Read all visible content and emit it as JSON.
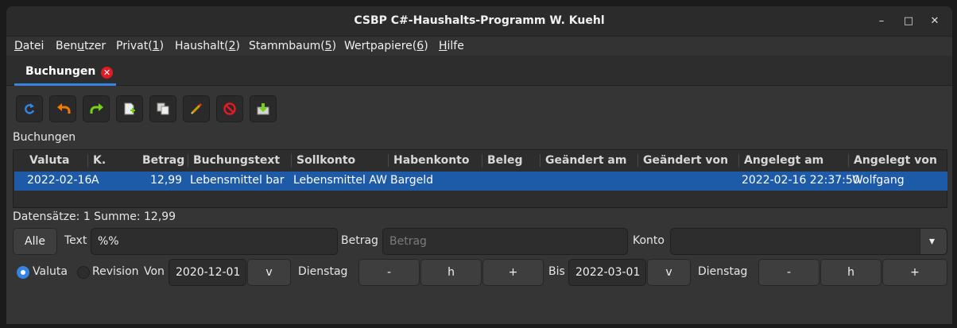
{
  "window": {
    "title": "CSBP C#-Haushalts-Programm W. Kuehl",
    "minimize_glyph": "–",
    "maximize_glyph": "□",
    "close_glyph": "✕"
  },
  "menu": [
    {
      "pre": "",
      "u": "D",
      "post": "atei"
    },
    {
      "pre": "Ben",
      "u": "u",
      "post": "tzer"
    },
    {
      "pre": "Privat(",
      "u": "1",
      "post": ")"
    },
    {
      "pre": "Haushalt(",
      "u": "2",
      "post": ")"
    },
    {
      "pre": "Stammbaum(",
      "u": "5",
      "post": ")"
    },
    {
      "pre": "Wertpapiere(",
      "u": "6",
      "post": ")"
    },
    {
      "pre": "",
      "u": "H",
      "post": "ilfe"
    }
  ],
  "tab": {
    "label": "Buchungen",
    "close_glyph": "✕"
  },
  "toolbar": {
    "icons": [
      "refresh-icon",
      "undo-icon",
      "redo-icon",
      "new-document-icon",
      "copy-icon",
      "edit-pencil-icon",
      "delete-icon",
      "export-icon"
    ],
    "colors": {
      "refresh": "#3584e4",
      "undo": "#f57900",
      "redo": "#73d216",
      "delete": "#e01b24"
    }
  },
  "section_label": "Buchungen",
  "table": {
    "columns": [
      "Valuta",
      "K.",
      "Betrag",
      "Buchungstext",
      "Sollkonto",
      "Habenkonto",
      "Beleg",
      "Geändert am",
      "Geändert von",
      "Angelegt am",
      "Angelegt von"
    ],
    "rows": [
      {
        "valuta": "2022-02-16",
        "k": "A",
        "betrag": "12,99",
        "buchungstext": "Lebensmittel bar",
        "sollkonto": "Lebensmittel AW",
        "habenkonto": "Bargeld",
        "beleg": "",
        "geaendert_am": "",
        "geaendert_von": "",
        "angelegt_am": "2022-02-16 22:37:50",
        "angelegt_von": "Wolfgang"
      }
    ],
    "selection_color": "#1d5aa8"
  },
  "status": "Datensätze: 1 Summe: 12,99",
  "filter": {
    "all_button": "Alle",
    "text_label": "Text",
    "text_value": "%%",
    "betrag_label": "Betrag",
    "betrag_placeholder": "Betrag",
    "konto_label": "Konto",
    "konto_value": "",
    "dropdown_glyph": "▾"
  },
  "daterange": {
    "radio_valuta": "Valuta",
    "radio_revision": "Revision",
    "selected": "Valuta",
    "from_label": "Von",
    "from_date": "2020-12-01",
    "from_weekday": "Dienstag",
    "to_label": "Bis",
    "to_date": "2022-03-01",
    "to_weekday": "Dienstag",
    "btn_v": "v",
    "btn_minus": "-",
    "btn_h": "h",
    "btn_plus": "+"
  }
}
